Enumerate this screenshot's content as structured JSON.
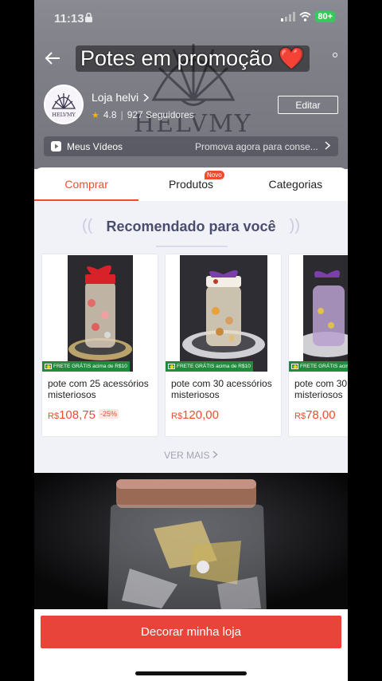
{
  "status": {
    "time": "11:13",
    "battery": "80+"
  },
  "header": {
    "overlay_title": "Potes em promoção",
    "heart": "❤️",
    "watermark": "HELVMY"
  },
  "store": {
    "name": "Loja helvi",
    "rating": "4.8",
    "followers": "927 Seguidores",
    "edit_label": "Editar",
    "videos_label": "Meus Vídeos",
    "videos_promo": "Promova agora para conse..."
  },
  "tabs": [
    {
      "label": "Comprar",
      "active": true
    },
    {
      "label": "Produtos",
      "badge": "Novo"
    },
    {
      "label": "Categorias"
    }
  ],
  "recommended": {
    "title": "Recomendado para você",
    "ver_mais": "VER MAIS",
    "frete": "FRETE GRÁTIS acima de R$10",
    "products": [
      {
        "title": "pote com 25 acessórios misteriosos",
        "currency": "R$",
        "price": "108,75",
        "discount": "-25%",
        "ribbon": "#d8222a"
      },
      {
        "title": "pote com 30 acessórios misteriosos",
        "currency": "R$",
        "price": "120,00",
        "discount": "",
        "ribbon": "#7a3fa8"
      },
      {
        "title": "pote com 30 acessórios misteriosos",
        "currency": "R$",
        "price": "78,00",
        "discount": "",
        "ribbon": "#7a3fa8"
      }
    ]
  },
  "footer": {
    "decorate_label": "Decorar minha loja"
  },
  "colors": {
    "accent": "#ee4d2d",
    "button": "#e8443a"
  }
}
